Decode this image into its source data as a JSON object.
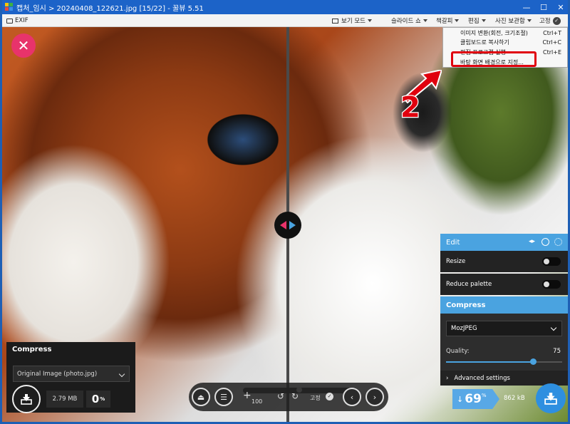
{
  "window": {
    "title": "캡처_임시 > 20240408_122621.jpg [15/22] - 꿀뷰 5.51",
    "controls": {
      "minimize": "—",
      "maximize": "☐",
      "close": "✕"
    }
  },
  "toolbar": {
    "exif_label": "EXIF",
    "menus": [
      "보기 모드",
      "슬라이드 쇼",
      "책갈피",
      "편집",
      "사진 보관함"
    ],
    "pin_label": "고정"
  },
  "context_menu": {
    "items": [
      {
        "label": "이미지 변환(회전, 크기조절)",
        "shortcut": "Ctrl+T"
      },
      {
        "label": "클립보드로 복사하기",
        "shortcut": "Ctrl+C"
      },
      {
        "label": "편집 프로그램 실행",
        "shortcut": "Ctrl+E"
      },
      {
        "label": "바탕 화면 배경으로 지정...",
        "shortcut": ""
      }
    ]
  },
  "annotation": {
    "step_number": "2",
    "highlight_color": "#e0000e"
  },
  "left_panel": {
    "title": "Compress",
    "selected_option": "Original Image (photo.jpg)",
    "file_size": "2.79 MB",
    "percent": "0",
    "percent_unit": "%"
  },
  "bottom_controls": {
    "zoom_label": "100",
    "pin_label": "고정",
    "zoom_fraction": 0.47
  },
  "edit_panel": {
    "title": "Edit",
    "resize_label": "Resize",
    "reduce_palette_label": "Reduce palette",
    "compress_title": "Compress",
    "codec": "MozJPEG",
    "quality_label": "Quality:",
    "quality_value": "75",
    "quality_fraction": 0.75,
    "advanced_label": "Advanced settings"
  },
  "right_result": {
    "arrow": "↓",
    "percent": "69",
    "percent_unit": "%",
    "file_size": "862 kB"
  },
  "colors": {
    "titlebar": "#1c63c8",
    "accent": "#4aa3e0",
    "close_button": "#e8336b"
  }
}
